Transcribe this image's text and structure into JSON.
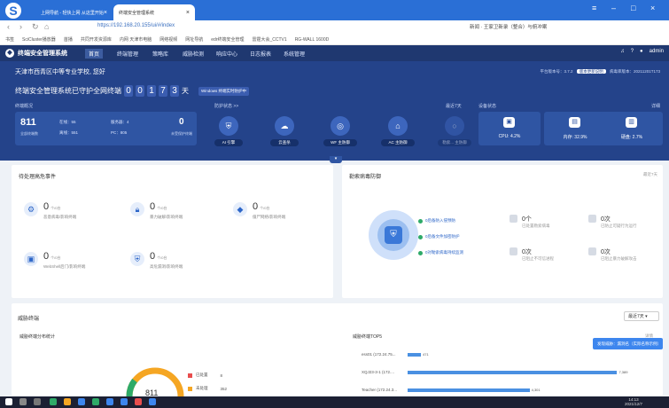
{
  "browser": {
    "tabs": [
      {
        "label": "上网导航 - 轻快上网 从这里开始"
      },
      {
        "label": "终端安全管理系统"
      }
    ],
    "url": "https://192.168.20.155/ui/#/index",
    "addr_right": "新闻 · 王家卫新录（整合）与俯冲案",
    "bookmarks": [
      "书签",
      "SciCluster播放器",
      "首播",
      "共同开发资源库",
      "内网 天津市电脑",
      "网络视频",
      "网址导航",
      "edr终端安全管理",
      "雷霆大会_CCTV1",
      "RG-WALL 1600D"
    ]
  },
  "app": {
    "name": "终端安全管理系统",
    "menus": [
      "首页",
      "终端管理",
      "策略库",
      "威胁检测",
      "响应中心",
      "日志报表",
      "系统管理"
    ],
    "user": "admin"
  },
  "dashboard": {
    "school": "天津市西青区中等专业学校, 您好",
    "version_text": "平台版本号：3.7.2",
    "version_button": "版本更新说明",
    "db_version": "病毒库版本：20211201T173",
    "guard_prefix": "终端安全管理系统已守护全网终端",
    "guard_digits": [
      "0",
      "0",
      "1",
      "7",
      "3"
    ],
    "guard_suffix": "天",
    "win_badge": "Windows 终端实时防护中",
    "section_label": "终端概况",
    "mid_label": "防护状态 >>",
    "period": "最近7天",
    "device_status": "设备状态",
    "more": "详细",
    "total_terminals": "811",
    "total_label": "全部终端数",
    "stats": [
      {
        "label": "在线：55"
      },
      {
        "label": "离线：551"
      },
      {
        "label": "服务器：4"
      },
      {
        "label": "PC：805"
      }
    ],
    "unprotected": "0",
    "unprotected_label": "未受保护终端",
    "agents": [
      {
        "label": "AI 引擎",
        "icon": "shield"
      },
      {
        "label": "云查杀",
        "icon": "cloud"
      },
      {
        "label": "WF 主防御",
        "icon": "target"
      },
      {
        "label": "AC 主防御",
        "icon": "house"
      },
      {
        "label": "勒索... 主防御",
        "icon": "circle"
      }
    ],
    "devices": [
      {
        "label": "CPU: 4.2%"
      },
      {
        "label": "内存: 32.9%"
      },
      {
        "label": "硬盘: 2.7%"
      }
    ]
  },
  "pending": {
    "title": "待处理高危事件",
    "items": [
      {
        "value": "0",
        "unit": "个/0台",
        "label": "恶意病毒/影响终端"
      },
      {
        "value": "0",
        "unit": "个/0台",
        "label": "暴力破解/影响终端"
      },
      {
        "value": "0",
        "unit": "个/0台",
        "label": "僵尸网络/影响终端"
      },
      {
        "value": "0",
        "unit": "个/0台",
        "label": "WebShell后门/影响终端"
      },
      {
        "value": "0",
        "unit": "个/0台",
        "label": "高危漏洞/影响终端"
      }
    ]
  },
  "ransom": {
    "title": "勒索病毒防御",
    "more": "最近7天",
    "checks": [
      "0后备防入侵预防",
      "0后备文件加密防护",
      "0对勒索病毒持续监测"
    ],
    "facts": [
      {
        "value": "0个",
        "label": "已处置勒索病毒"
      },
      {
        "value": "0次",
        "label": "已防止可疑行为运行"
      },
      {
        "value": "0次",
        "label": "已阻止不可信进程"
      },
      {
        "value": "0次",
        "label": "已阻止暴力破解攻击"
      }
    ]
  },
  "threat": {
    "title": "威胁终端",
    "period": "最近7天",
    "dist_title": "威胁终端分布统计",
    "donut_total": "811",
    "legend": [
      {
        "label": "已处置",
        "value": "8",
        "color": "#e84d4d"
      },
      {
        "label": "未处理",
        "value": "352",
        "color": "#f5a623"
      }
    ],
    "top_title": "威胁终端TOP5",
    "top_more": "详情",
    "bars": [
      {
        "name": "ess01 (172.24.75...",
        "value": 471,
        "label": "471"
      },
      {
        "name": "XQJ23-3-1 (172....",
        "value": 7389,
        "label": "7,389"
      },
      {
        "name": "Teacher (172.24.3...",
        "value": 4301,
        "label": "4,301"
      }
    ],
    "tooltip": "发现威胁：漏洞名（实际名称示例）"
  },
  "taskbar": {
    "time": "14:13",
    "date": "2021/12/7"
  }
}
